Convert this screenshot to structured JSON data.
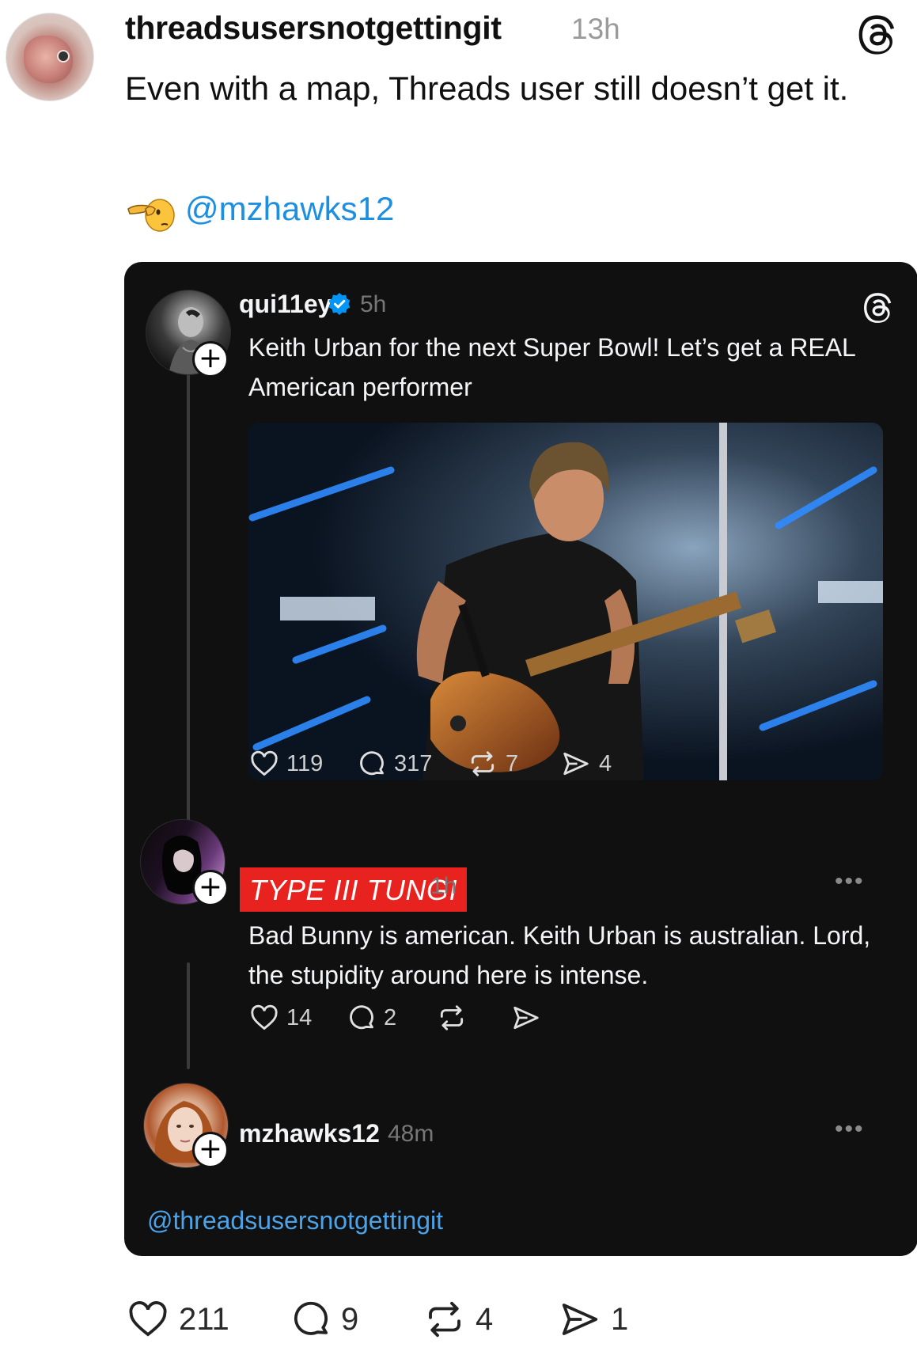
{
  "post": {
    "username": "threadsusersnotgettingit",
    "time": "13h",
    "text": "Even with a map, Threads user still doesn’t get it.",
    "mention": "@mzhawks12",
    "stats": {
      "likes": "211",
      "replies": "9",
      "reposts": "4",
      "shares": "1"
    }
  },
  "quoted": {
    "original": {
      "username": "qui11ey",
      "time": "5h",
      "text": "Keith Urban for the next Super Bowl! Let’s get a REAL American performer",
      "stats": {
        "likes": "119",
        "replies": "317",
        "reposts": "7",
        "shares": "4"
      }
    },
    "reply": {
      "username_banner": "TYPE III TUNGI",
      "time": "1h",
      "text": "Bad Bunny is american. Keith Urban is australian. Lord, the stupidity around here is intense.",
      "stats": {
        "likes": "14",
        "replies": "2"
      }
    },
    "third": {
      "username": "mzhawks12",
      "time": "48m",
      "mention": "@threadsusersnotgettingit"
    }
  },
  "colors": {
    "card_bg": "#101010",
    "mention_blue": "#1d8fe1",
    "banner_red": "#e8221f",
    "verified_blue": "#0095f6"
  },
  "icons": [
    "threads-logo-icon",
    "pointing-hand-emoji",
    "verified-badge-icon",
    "heart-icon",
    "comment-icon",
    "repost-icon",
    "share-icon",
    "more-dots-icon",
    "follow-plus-icon"
  ]
}
